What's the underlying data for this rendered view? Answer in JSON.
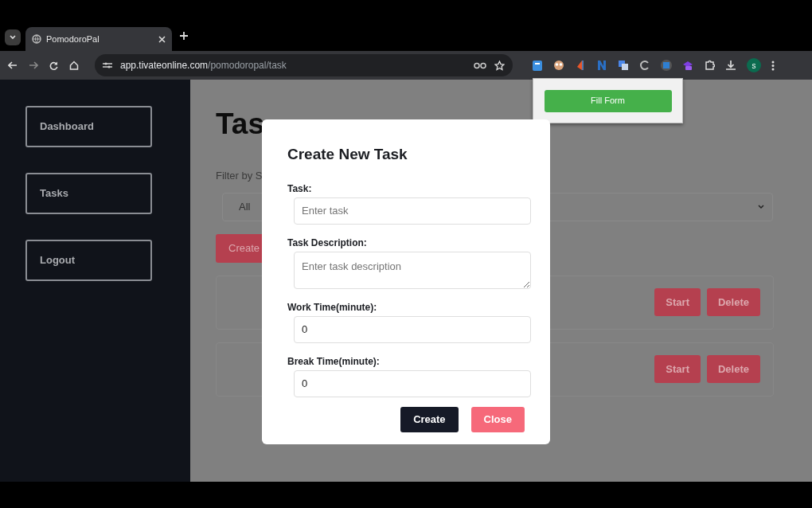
{
  "browser": {
    "tab": {
      "title": "PomodoroPal"
    },
    "url": {
      "host": "app.tivateonline.com",
      "path": "/pomodoropal/task"
    },
    "profile_initial": "s"
  },
  "extension_popup": {
    "button": "Fill Form"
  },
  "sidebar": {
    "items": [
      {
        "label": "Dashboard"
      },
      {
        "label": "Tasks"
      },
      {
        "label": "Logout"
      }
    ]
  },
  "page": {
    "title": "Tas",
    "filter_label": "Filter by S",
    "filter_value": "All",
    "create_button": "Create",
    "tasks": [
      {
        "buttons": [
          "Start",
          "Delete"
        ]
      },
      {
        "buttons": [
          "Start",
          "Delete"
        ]
      }
    ]
  },
  "modal": {
    "title": "Create New Task",
    "fields": [
      {
        "label": "Task:",
        "placeholder": "Enter task",
        "kind": "input"
      },
      {
        "label": "Task Description:",
        "placeholder": "Enter task description",
        "kind": "textarea"
      },
      {
        "label": "Work Time(minute):",
        "value": "0",
        "kind": "input"
      },
      {
        "label": "Break Time(minute):",
        "value": "0",
        "kind": "input"
      }
    ],
    "buttons": [
      {
        "label": "Create",
        "kind": "primary"
      },
      {
        "label": "Close",
        "kind": "secondary"
      }
    ]
  }
}
